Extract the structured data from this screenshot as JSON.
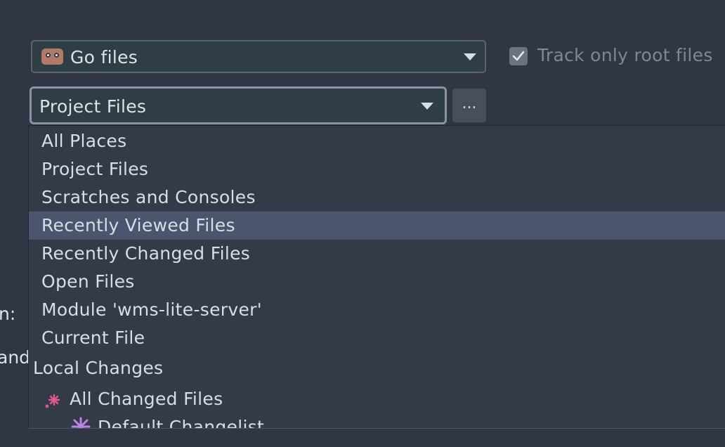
{
  "file_type_combo": {
    "value": "Go files",
    "icon": "gopher-icon"
  },
  "track_root": {
    "label": "Track only root files",
    "checked": true
  },
  "scope_combo": {
    "value": "Project Files"
  },
  "more_button": {
    "label": "..."
  },
  "side_fragments": {
    "line1": "n:",
    "line2": "and"
  },
  "scope_menu": {
    "options": [
      "All Places",
      "Project Files",
      "Scratches and Consoles",
      "Recently Viewed Files",
      "Recently Changed Files",
      "Open Files",
      "Module 'wms-lite-server'",
      "Current File"
    ],
    "selected": "Recently Viewed Files",
    "group_label": "Local Changes",
    "group_items": [
      {
        "label": "All Changed Files",
        "icon": "changed-files-icon",
        "color": "#e05a8a"
      },
      {
        "label": "Default Changelist",
        "icon": "changelist-icon",
        "color": "#b884e8"
      }
    ]
  },
  "colors": {
    "background": "#313644",
    "selection": "#4b566e",
    "accent_border": "#8a93a8"
  }
}
